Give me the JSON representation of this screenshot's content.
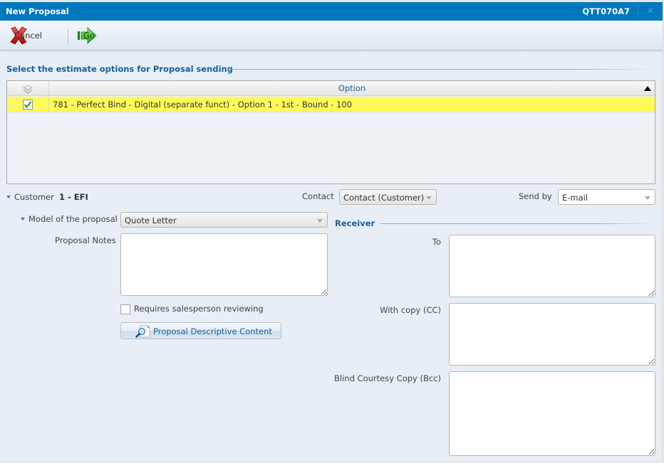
{
  "window": {
    "title": "New Proposal",
    "code": "QTT070A7",
    "close_icon": "close-icon"
  },
  "toolbar": {
    "cancel_label": "Cancel",
    "cancel_icon": "red-x-icon",
    "go_label": "Go",
    "go_icon": "green-arrow-icon"
  },
  "estimate_section": {
    "title": "Select the estimate options for Proposal sending",
    "grid": {
      "columns": [
        {
          "key": "select",
          "header_icon": "select-all-icon"
        },
        {
          "key": "option",
          "label": "Option",
          "sort": "ascending"
        }
      ],
      "rows": [
        {
          "selected": true,
          "option": "781 - Perfect Bind - Digital (separate funct) - Option 1 - 1st - Bound - 100",
          "highlight_color": "#fffa5b"
        }
      ]
    }
  },
  "customer": {
    "label": "Customer",
    "value": "1 - EFI"
  },
  "contact": {
    "label": "Contact",
    "value": "Contact (Customer)"
  },
  "send_by": {
    "label": "Send by",
    "value": "E-mail"
  },
  "model": {
    "label": "Model of the proposal",
    "value": "Quote Letter"
  },
  "proposal_notes": {
    "label": "Proposal Notes",
    "value": ""
  },
  "requires_review": {
    "label": "Requires salesperson reviewing",
    "checked": false
  },
  "descriptive_content_button": {
    "label": "Proposal Descriptive Content",
    "icon": "document-search-icon"
  },
  "receiver": {
    "title": "Receiver",
    "to": {
      "label": "To",
      "value": ""
    },
    "cc": {
      "label": "With copy (CC)",
      "value": ""
    },
    "bcc": {
      "label": "Blind Courtesy Copy (Bcc)",
      "value": ""
    }
  },
  "colors": {
    "titlebar": "#0177bd",
    "accent_text": "#17609c",
    "background": "#e7eef6",
    "selected_row": "#fffa5b"
  }
}
